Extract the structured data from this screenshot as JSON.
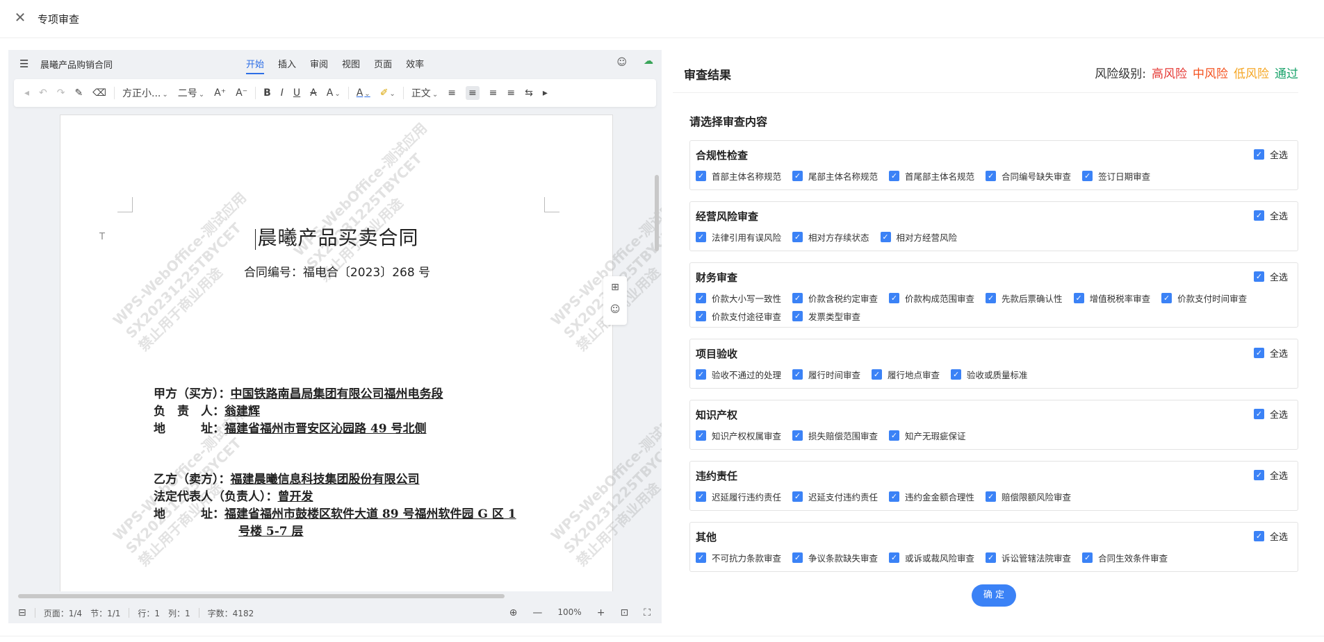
{
  "header": {
    "title": "专项审查"
  },
  "editor": {
    "doc_name": "晨曦产品购销合同",
    "tabs": [
      {
        "label": "开始",
        "active": true
      },
      {
        "label": "插入"
      },
      {
        "label": "审阅"
      },
      {
        "label": "视图"
      },
      {
        "label": "页面"
      },
      {
        "label": "效率"
      }
    ],
    "toolbar": {
      "font_name": "方正小...",
      "font_size": "二号",
      "style": "正文"
    },
    "document": {
      "title": "晨曦产品买卖合同",
      "contract_no": "合同编号：福电合〔2023〕268 号",
      "party_a": [
        {
          "label": "甲方（买方）：",
          "value": "中国铁路南昌局集团有限公司福州电务段"
        },
        {
          "label": "负　责　人：",
          "value": "翁建辉"
        },
        {
          "label": "地　　　址：",
          "value": "福建省福州市晋安区沁园路 49 号北侧"
        }
      ],
      "party_b": [
        {
          "label": "乙方（卖方）：",
          "value": "福建晨曦信息科技集团股份有限公司"
        },
        {
          "label": "法定代表人（负责人）：",
          "value": "曾开发"
        },
        {
          "label": "地　　　址：",
          "value": "福建省福州市鼓楼区软件大道 89 号福州软件园 G 区 1"
        },
        {
          "label": "",
          "value": "号楼 5-7 层"
        }
      ],
      "watermark": "WPS-WebOffice-测试应用\nSX20231225TBYCET\n禁止用于商业用途"
    },
    "status": {
      "page": "页面：1/4",
      "section": "节：1/1",
      "row": "行：1",
      "col": "列：1",
      "words": "字数：4182",
      "zoom": "100%"
    }
  },
  "review": {
    "title": "审查结果",
    "risk_label": "风险级别:",
    "risk_levels": [
      {
        "label": "高风险",
        "color": "#e53935"
      },
      {
        "label": "中风险",
        "color": "#f4511e"
      },
      {
        "label": "低风险",
        "color": "#f5a623"
      },
      {
        "label": "通过",
        "color": "#1aa36b"
      }
    ],
    "section_title": "请选择审查内容",
    "select_all_label": "全选",
    "categories": [
      {
        "title": "合规性检查",
        "items": [
          "首部主体名称规范",
          "尾部主体名称规范",
          "首尾部主体名规范",
          "合同编号缺失审查",
          "签订日期审查"
        ]
      },
      {
        "title": "经营风险审查",
        "items": [
          "法律引用有误风险",
          "相对方存续状态",
          "相对方经营风险"
        ]
      },
      {
        "title": "财务审查",
        "items": [
          "价款大小写一致性",
          "价款含税约定审查",
          "价款构成范围审查",
          "先款后票确认性",
          "增值税税率审查",
          "价款支付时间审查",
          "价款支付途径审查",
          "发票类型审查"
        ]
      },
      {
        "title": "项目验收",
        "items": [
          "验收不通过的处理",
          "履行时间审查",
          "履行地点审查",
          "验收或质量标准"
        ]
      },
      {
        "title": "知识产权",
        "items": [
          "知识产权权属审查",
          "损失赔偿范围审查",
          "知产无瑕疵保证"
        ]
      },
      {
        "title": "违约责任",
        "items": [
          "迟延履行违约责任",
          "迟延支付违约责任",
          "违约金金额合理性",
          "赔偿限额风险审查"
        ]
      },
      {
        "title": "其他",
        "items": [
          "不可抗力条款审查",
          "争议条款缺失审查",
          "或诉或裁风险审查",
          "诉讼管辖法院审查",
          "合同生效条件审查"
        ]
      }
    ],
    "confirm_label": "确 定"
  }
}
